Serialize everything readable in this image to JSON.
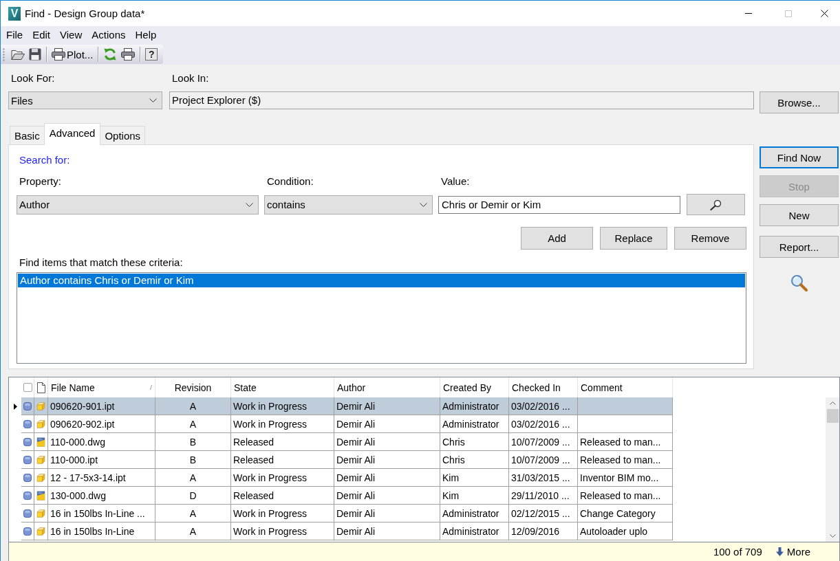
{
  "window": {
    "logo": "V",
    "title": "Find - Design Group data*",
    "maximize_disabled": true
  },
  "menu": [
    "File",
    "Edit",
    "View",
    "Actions",
    "Help"
  ],
  "toolbar": {
    "groups": [
      [
        {
          "kind": "open"
        },
        {
          "kind": "save"
        }
      ],
      [
        {
          "kind": "plot",
          "label": "Plot..."
        }
      ],
      [
        {
          "kind": "refresh"
        },
        {
          "kind": "print"
        }
      ],
      [
        {
          "kind": "help",
          "label": "?"
        }
      ]
    ]
  },
  "look_for": {
    "label": "Look For:",
    "value": "Files"
  },
  "look_in": {
    "label": "Look In:",
    "value": "Project Explorer ($)"
  },
  "browse_button": {
    "label": "Browse..."
  },
  "tabs": [
    {
      "label": "Basic",
      "selected": false
    },
    {
      "label": "Advanced",
      "selected": true
    },
    {
      "label": "Options",
      "selected": false
    }
  ],
  "advanced": {
    "heading": "Search for:",
    "property": {
      "label": "Property:",
      "value": "Author"
    },
    "condition": {
      "label": "Condition:",
      "value": "contains"
    },
    "value": {
      "label": "Value:",
      "value": "Chris or Demir or Kim"
    },
    "buttons": [
      "Add",
      "Replace",
      "Remove"
    ],
    "criteria_label": "Find items that match these criteria:",
    "criteria": [
      {
        "text": "Author contains Chris or Demir or Kim",
        "selected": true
      }
    ]
  },
  "actions": [
    {
      "label": "Find Now",
      "default": true,
      "disabled": false
    },
    {
      "label": "Stop",
      "default": false,
      "disabled": true
    },
    {
      "label": "New",
      "default": false,
      "disabled": false
    },
    {
      "label": "Report...",
      "default": false,
      "disabled": false
    }
  ],
  "table": {
    "select_all": {
      "checked": false
    },
    "columns": [
      "File Name",
      "Revision",
      "State",
      "Author",
      "Created By",
      "Checked In",
      "Comment"
    ],
    "rows": [
      {
        "kind": "part",
        "selected": true,
        "file_name": "090620-901.ipt",
        "revision": "A",
        "state": "Work in Progress",
        "author": "Demir Ali",
        "created_by": "Administrator",
        "checked_in": "03/02/2016 ..."
      },
      {
        "kind": "part",
        "selected": false,
        "file_name": "090620-902.ipt",
        "revision": "A",
        "state": "Work in Progress",
        "author": "Demir Ali",
        "created_by": "Administrator",
        "checked_in": "03/02/2016 ..."
      },
      {
        "kind": "drawing",
        "selected": false,
        "file_name": "110-000.dwg",
        "revision": "B",
        "state": "Released",
        "author": "Demir Ali",
        "created_by": "Chris",
        "checked_in": "10/07/2009 ...",
        "comment": "Released to man..."
      },
      {
        "kind": "part",
        "selected": false,
        "file_name": "110-000.ipt",
        "revision": "B",
        "state": "Released",
        "author": "Demir Ali",
        "created_by": "Chris",
        "checked_in": "10/07/2009 ...",
        "comment": "Released to man..."
      },
      {
        "kind": "part",
        "selected": false,
        "file_name": "12 - 17-5x3-14.ipt",
        "revision": "A",
        "state": "Work in Progress",
        "author": "Demir Ali",
        "created_by": "Kim",
        "checked_in": "31/03/2015 ...",
        "comment": "Inventor BIM mo..."
      },
      {
        "kind": "drawing",
        "selected": false,
        "file_name": "130-000.dwg",
        "revision": "D",
        "state": "Released",
        "author": "Demir Ali",
        "created_by": "Kim",
        "checked_in": "29/11/2010 ...",
        "comment": "Released to man..."
      },
      {
        "kind": "part",
        "selected": false,
        "file_name": "16 in 150lbs In-Line ...",
        "revision": "A",
        "state": "Work in Progress",
        "author": "Demir Ali",
        "created_by": "Administrator",
        "checked_in": "02/12/2015 ...",
        "comment": "Change Category"
      },
      {
        "kind": "part",
        "selected": false,
        "file_name": "16 in 150lbs In-Line",
        "revision": "A",
        "state": "Work in Progress",
        "author": "Demir Ali",
        "created_by": "Administrator",
        "checked_in": "12/09/2016",
        "comment": "Autoloader uplo"
      }
    ]
  },
  "status_bar": {
    "count": "100 of 709",
    "more": "More"
  }
}
